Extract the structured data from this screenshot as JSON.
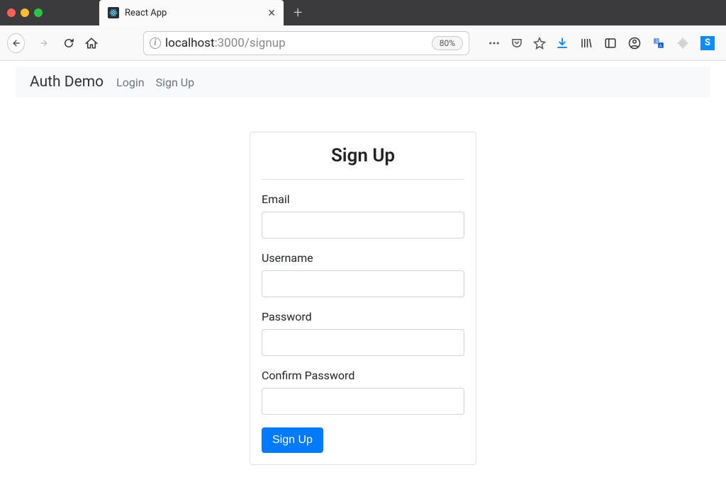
{
  "browser": {
    "tab_title": "React App",
    "url_host": "localhost",
    "url_port_path": ":3000/signup",
    "zoom": "80%"
  },
  "stylish_badge": "S",
  "app": {
    "brand": "Auth Demo",
    "nav": {
      "login": "Login",
      "signup": "Sign Up"
    }
  },
  "form": {
    "heading": "Sign Up",
    "email_label": "Email",
    "username_label": "Username",
    "password_label": "Password",
    "confirm_label": "Confirm Password",
    "submit_label": "Sign Up",
    "email_value": "",
    "username_value": "",
    "password_value": "",
    "confirm_value": ""
  }
}
